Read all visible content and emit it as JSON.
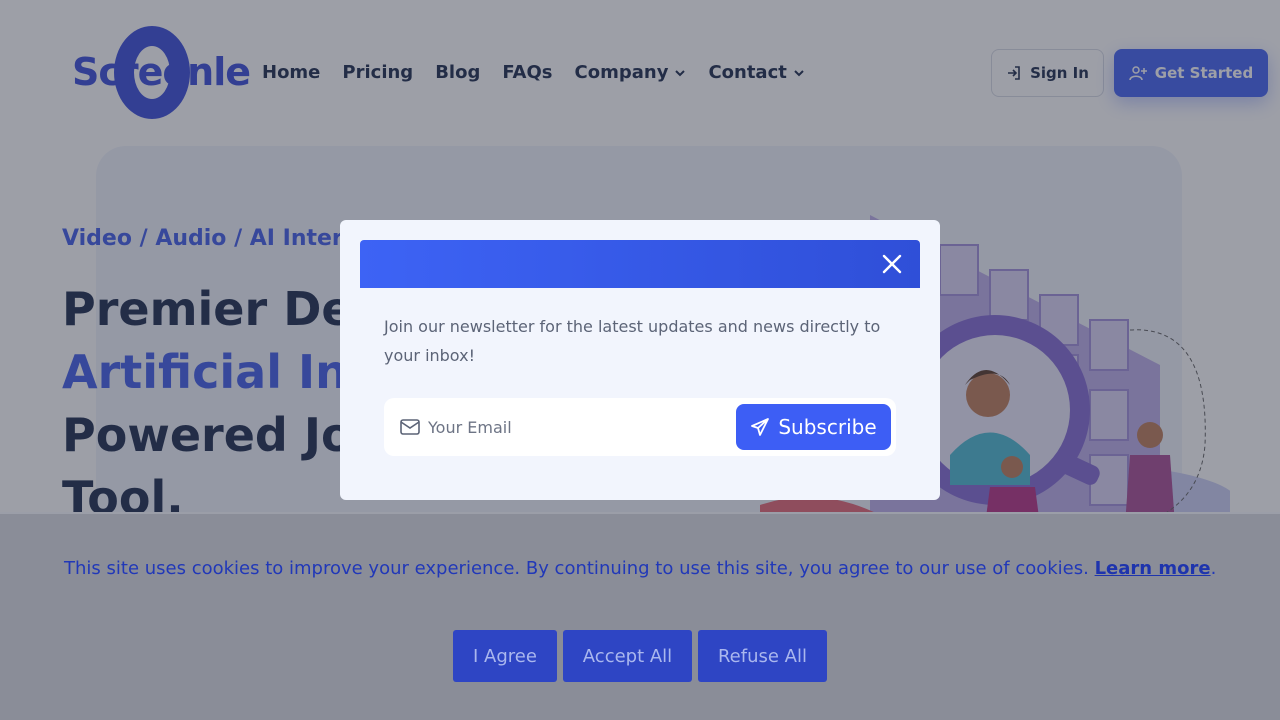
{
  "header": {
    "logo_text": "Screenle",
    "nav": [
      {
        "label": "Home",
        "dropdown": false
      },
      {
        "label": "Pricing",
        "dropdown": false
      },
      {
        "label": "Blog",
        "dropdown": false
      },
      {
        "label": "FAQs",
        "dropdown": false
      },
      {
        "label": "Company",
        "dropdown": true
      },
      {
        "label": "Contact",
        "dropdown": true
      }
    ],
    "sign_in": "Sign In",
    "get_started": "Get Started"
  },
  "hero": {
    "subtitle": "Video / Audio / AI Inter",
    "headline_line1": "Premier De",
    "headline_line2": "Artificial In",
    "headline_line3": "Powered Jo",
    "headline_line4": "Tool."
  },
  "modal": {
    "text": "Join our newsletter for the latest updates and news directly to your inbox!",
    "email_placeholder": "Your Email",
    "email_value": "",
    "subscribe_label": "Subscribe"
  },
  "cookie": {
    "text": "This site uses cookies to improve your experience. By continuing to use this site, you agree to our use of cookies.",
    "link": "Learn more",
    "period": ".",
    "buttons": {
      "agree": "I Agree",
      "accept_all": "Accept All",
      "refuse_all": "Refuse All"
    }
  },
  "colors": {
    "brand": "#3556f0",
    "accent_text": "#3250e6",
    "dark_text": "#0b1b3f",
    "overlay": "rgba(60,64,80,0.5)"
  },
  "icons": {
    "sign_in": "login-icon",
    "get_started": "user-plus-icon",
    "close": "close-icon",
    "mail": "mail-icon",
    "subscribe": "send-icon"
  }
}
